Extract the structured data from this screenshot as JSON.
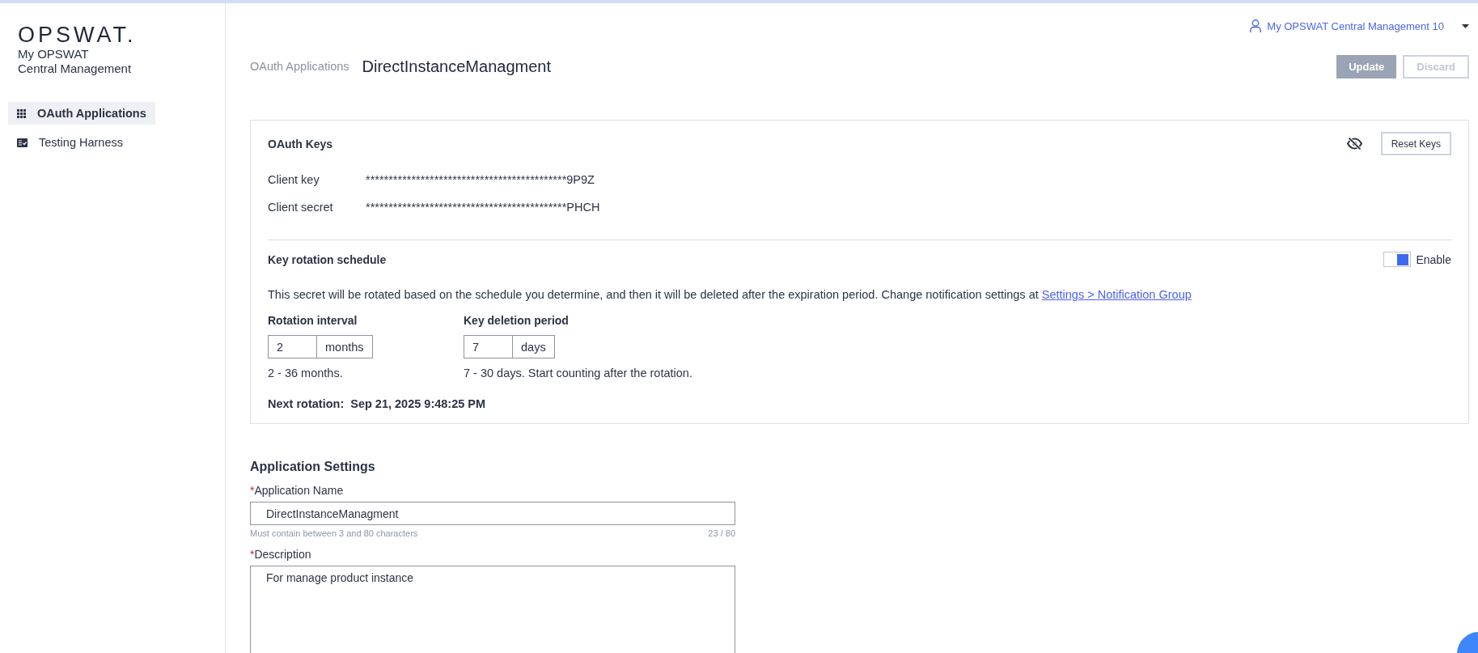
{
  "sidebar": {
    "logo": "OPSWAT.",
    "product_name_lines": [
      "My OPSWAT",
      "Central Management"
    ],
    "items": [
      {
        "label": "OAuth Applications",
        "selected": true
      },
      {
        "label": "Testing Harness",
        "selected": false
      }
    ]
  },
  "user_menu": {
    "label": "My OPSWAT Central Management 10"
  },
  "breadcrumb": {
    "parent": "OAuth Applications",
    "title": "DirectInstanceManagment"
  },
  "actions": [
    {
      "label": "Update",
      "kind": "primary",
      "disabled": true
    },
    {
      "label": "Discard",
      "kind": "secondary",
      "disabled": true
    }
  ],
  "oauth_keys": {
    "title": "OAuth Keys",
    "reset_button": "Reset Keys",
    "keys_hidden": true,
    "keys": [
      {
        "label": "Client key",
        "value": "********************************************9P9Z"
      },
      {
        "label": "Client secret",
        "value": "********************************************PHCH"
      }
    ]
  },
  "rotation": {
    "title": "Key rotation schedule",
    "enabled": true,
    "enable_label": "Enable",
    "description": "This secret will be rotated based on the schedule you determine, and then it will be deleted after the expiration period. Change notification settings at ",
    "link": "Settings > Notification Group",
    "fields": [
      {
        "label": "Rotation interval",
        "value": "2",
        "unit": "months",
        "hint": "2 - 36 months."
      },
      {
        "label": "Key deletion period",
        "value": "7",
        "unit": "days",
        "hint": "7 - 30 days. Start counting after the rotation."
      }
    ],
    "next_label": "Next rotation:",
    "next_value": "Sep 21, 2025 9:48:25 PM"
  },
  "application_settings": {
    "title": "Application Settings",
    "fields": [
      {
        "kind": "input",
        "label": "Application Name",
        "required_mark": "*",
        "value": "DirectInstanceManagment",
        "hint": "Must contain between 3 and 80 characters",
        "counter": "23 / 80"
      },
      {
        "kind": "textarea",
        "label": "Description",
        "required_mark": "*",
        "value": "For manage product instance"
      }
    ]
  }
}
